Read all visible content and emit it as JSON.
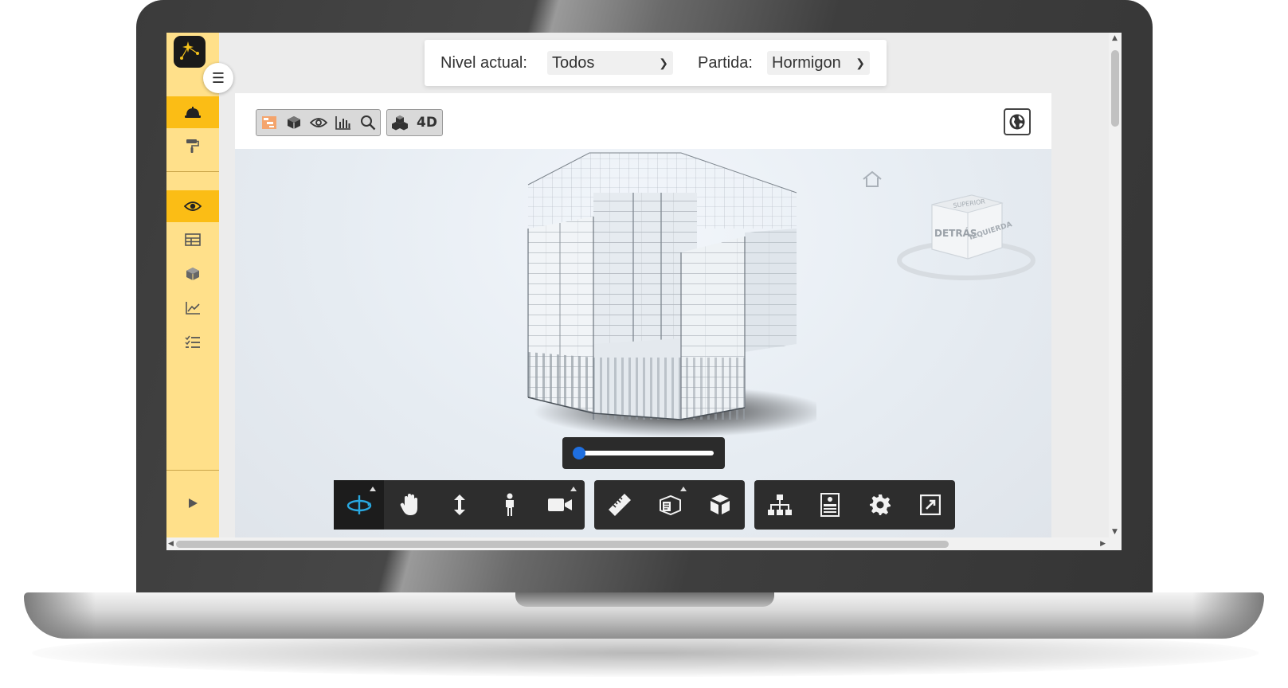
{
  "filters": {
    "level_label": "Nivel actual:",
    "level_value": "Todos",
    "partida_label": "Partida:",
    "partida_value": "Hormigon"
  },
  "viewer": {
    "tab_4d_label": "4D",
    "viewcube_front_label": "DETRÁS",
    "viewcube_side_label": "IZQUIERDA",
    "viewcube_top_label": "SUPERIOR"
  },
  "sidebar": {
    "items": [
      {
        "icon": "helmet-icon",
        "active": true
      },
      {
        "icon": "paint-roller-icon",
        "active": false
      },
      {
        "icon": "eye-icon",
        "active": true
      },
      {
        "icon": "table-icon",
        "active": false
      },
      {
        "icon": "cube-icon",
        "active": false
      },
      {
        "icon": "line-chart-icon",
        "active": false
      },
      {
        "icon": "checklist-icon",
        "active": false
      },
      {
        "icon": "play-icon",
        "active": false
      }
    ]
  },
  "timeline": {
    "progress": 0.0
  },
  "colors": {
    "sidebar": "#ffe08a",
    "sidebar_active": "#fbbd15",
    "toolbar_dark": "#2d2d2d",
    "accent_blue": "#1f6fe0",
    "orbit_active": "#29a8e0"
  }
}
